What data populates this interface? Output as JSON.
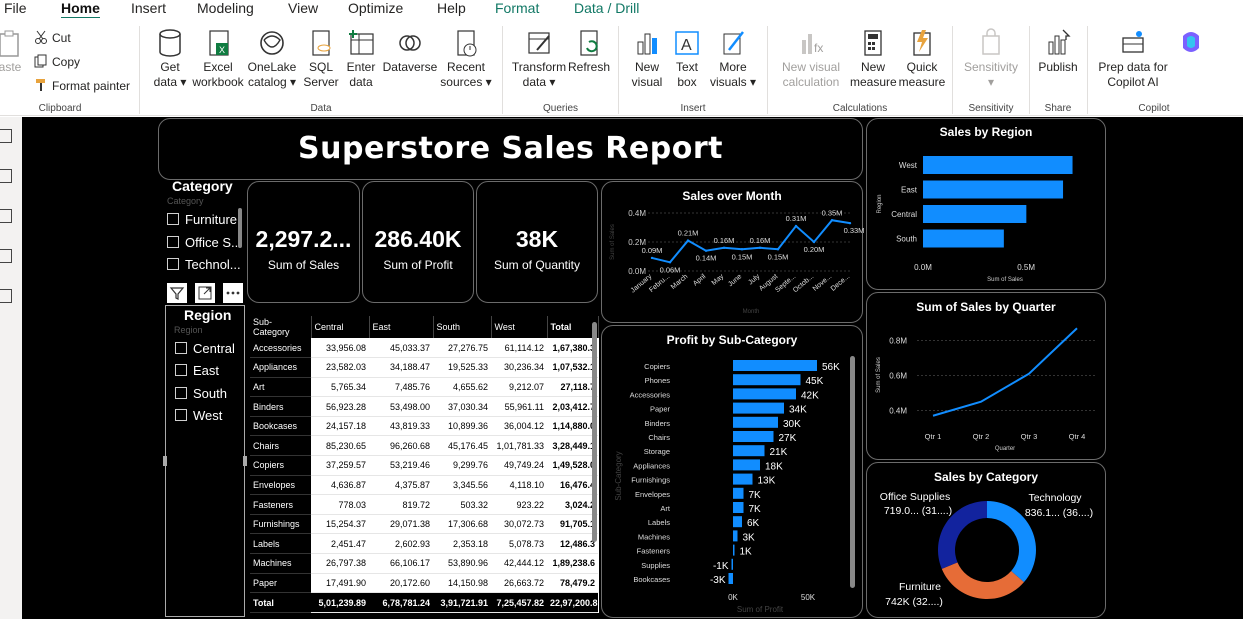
{
  "menu": {
    "items": [
      "File",
      "Home",
      "Insert",
      "Modeling",
      "View",
      "Optimize",
      "Help",
      "Format",
      "Data / Drill"
    ],
    "active": "Home"
  },
  "ribbon": {
    "clipboard": {
      "paste": "aste",
      "cut": "Cut",
      "copy": "Copy",
      "format_painter": "Format painter",
      "group": "Clipboard"
    },
    "data": {
      "get_data": "Get data",
      "excel": "Excel workbook",
      "onelake": "OneLake catalog",
      "sql": "SQL Server",
      "enter": "Enter data",
      "dataverse": "Dataverse",
      "recent": "Recent sources",
      "group": "Data"
    },
    "queries": {
      "transform": "Transform data",
      "refresh": "Refresh",
      "group": "Queries"
    },
    "insert": {
      "new_visual": "New visual",
      "text_box": "Text box",
      "more_visuals": "More visuals",
      "group": "Insert"
    },
    "calculations": {
      "new_visual_calc": "New visual calculation",
      "new_measure": "New measure",
      "quick_measure": "Quick measure",
      "group": "Calculations"
    },
    "sensitivity": {
      "label": "Sensitivity",
      "group": "Sensitivity"
    },
    "share": {
      "publish": "Publish",
      "group": "Share"
    },
    "copilot": {
      "prep": "Prep data for Copilot AI",
      "group": "Copilot"
    }
  },
  "report": {
    "title": "Superstore Sales Report",
    "kpis": [
      {
        "value": "2,297.2...",
        "label": "Sum of Sales"
      },
      {
        "value": "286.40K",
        "label": "Sum of Profit"
      },
      {
        "value": "38K",
        "label": "Sum of Quantity"
      }
    ],
    "category_slicer": {
      "title": "Category",
      "sub": "Category",
      "items": [
        "Furniture",
        "Office S...",
        "Technol..."
      ]
    },
    "region_slicer": {
      "title": "Region",
      "sub": "Region",
      "items": [
        "Central",
        "East",
        "South",
        "West"
      ]
    },
    "matrix": {
      "headers": [
        "Sub-Category",
        "Central",
        "East",
        "South",
        "West",
        "Total"
      ],
      "rows": [
        [
          "Accessories",
          "33,956.08",
          "45,033.37",
          "27,276.75",
          "61,114.12",
          "1,67,380.3"
        ],
        [
          "Appliances",
          "23,582.03",
          "34,188.47",
          "19,525.33",
          "30,236.34",
          "1,07,532.1"
        ],
        [
          "Art",
          "5,765.34",
          "7,485.76",
          "4,655.62",
          "9,212.07",
          "27,118.7"
        ],
        [
          "Binders",
          "56,923.28",
          "53,498.00",
          "37,030.34",
          "55,961.11",
          "2,03,412.7"
        ],
        [
          "Bookcases",
          "24,157.18",
          "43,819.33",
          "10,899.36",
          "36,004.12",
          "1,14,880.0"
        ],
        [
          "Chairs",
          "85,230.65",
          "96,260.68",
          "45,176.45",
          "1,01,781.33",
          "3,28,449.1"
        ],
        [
          "Copiers",
          "37,259.57",
          "53,219.46",
          "9,299.76",
          "49,749.24",
          "1,49,528.0"
        ],
        [
          "Envelopes",
          "4,636.87",
          "4,375.87",
          "3,345.56",
          "4,118.10",
          "16,476.4"
        ],
        [
          "Fasteners",
          "778.03",
          "819.72",
          "503.32",
          "923.22",
          "3,024.2"
        ],
        [
          "Furnishings",
          "15,254.37",
          "29,071.38",
          "17,306.68",
          "30,072.73",
          "91,705.1"
        ],
        [
          "Labels",
          "2,451.47",
          "2,602.93",
          "2,353.18",
          "5,078.73",
          "12,486.3"
        ],
        [
          "Machines",
          "26,797.38",
          "66,106.17",
          "53,890.96",
          "42,444.12",
          "1,89,238.6"
        ],
        [
          "Paper",
          "17,491.90",
          "20,172.60",
          "14,150.98",
          "26,663.72",
          "78,479.2"
        ]
      ],
      "total": [
        "Total",
        "5,01,239.89",
        "6,78,781.24",
        "3,91,721.91",
        "7,25,457.82",
        "22,97,200.8"
      ]
    }
  },
  "chart_data": [
    {
      "type": "line",
      "title": "Sales over Month",
      "xlabel": "Month",
      "ylabel": "Sum of Sales",
      "categories": [
        "January",
        "Febru...",
        "March",
        "April",
        "May",
        "June",
        "July",
        "August",
        "Septe...",
        "Octob...",
        "Nove...",
        "Dece..."
      ],
      "values": [
        0.09,
        0.06,
        0.21,
        0.14,
        0.16,
        0.15,
        0.16,
        0.15,
        0.31,
        0.2,
        0.35,
        0.33
      ],
      "data_labels": [
        "0.09M",
        "0.06M",
        "0.21M",
        "0.14M",
        "0.16M",
        "0.15M",
        "0.16M",
        "0.15M",
        "0.31M",
        "0.20M",
        "0.35M",
        "0.33M"
      ],
      "y_ticks": [
        "0.0M",
        "0.2M",
        "0.4M"
      ],
      "ylim": [
        0,
        0.4
      ],
      "color": "#118DFF"
    },
    {
      "type": "bar",
      "orientation": "horizontal",
      "title": "Sales by Region",
      "xlabel": "Sum of Sales",
      "ylabel": "Region",
      "categories": [
        "West",
        "East",
        "Central",
        "South"
      ],
      "values": [
        0.725,
        0.679,
        0.501,
        0.392
      ],
      "x_ticks": [
        "0.0M",
        "0.5M"
      ],
      "xlim": [
        0,
        0.8
      ],
      "color": "#118DFF"
    },
    {
      "type": "bar",
      "orientation": "horizontal",
      "title": "Profit by Sub-Category",
      "xlabel": "Sum of Profit",
      "ylabel": "Sub-Category",
      "categories": [
        "Copiers",
        "Phones",
        "Accessories",
        "Paper",
        "Binders",
        "Chairs",
        "Storage",
        "Appliances",
        "Furnishings",
        "Envelopes",
        "Art",
        "Labels",
        "Machines",
        "Fasteners",
        "Supplies",
        "Bookcases"
      ],
      "values": [
        56,
        45,
        42,
        34,
        30,
        27,
        21,
        18,
        13,
        7,
        7,
        6,
        3,
        1,
        -1,
        -3
      ],
      "data_labels": [
        "56K",
        "45K",
        "42K",
        "34K",
        "30K",
        "27K",
        "21K",
        "18K",
        "13K",
        "7K",
        "7K",
        "6K",
        "3K",
        "1K",
        "-1K",
        "-3K"
      ],
      "x_ticks": [
        "0K",
        "50K"
      ],
      "xlim": [
        -3,
        70
      ],
      "color": "#118DFF"
    },
    {
      "type": "line",
      "title": "Sum of Sales by Quarter",
      "xlabel": "Quarter",
      "ylabel": "Sum of Sales",
      "categories": [
        "Qtr 1",
        "Qtr 2",
        "Qtr 3",
        "Qtr 4"
      ],
      "values": [
        0.37,
        0.45,
        0.61,
        0.87
      ],
      "y_ticks": [
        "0.4M",
        "0.6M",
        "0.8M"
      ],
      "ylim": [
        0.3,
        0.9
      ],
      "color": "#118DFF"
    },
    {
      "type": "pie",
      "donut": true,
      "title": "Sales by Category",
      "categories": [
        "Technology",
        "Furniture",
        "Office Supplies"
      ],
      "values": [
        836.1,
        742,
        719.0
      ],
      "data_labels": [
        "836.1... (36....)",
        "742K (32....)",
        "719.0... (31....)"
      ],
      "colors": [
        "#118DFF",
        "#E66C37",
        "#12239E"
      ]
    }
  ]
}
